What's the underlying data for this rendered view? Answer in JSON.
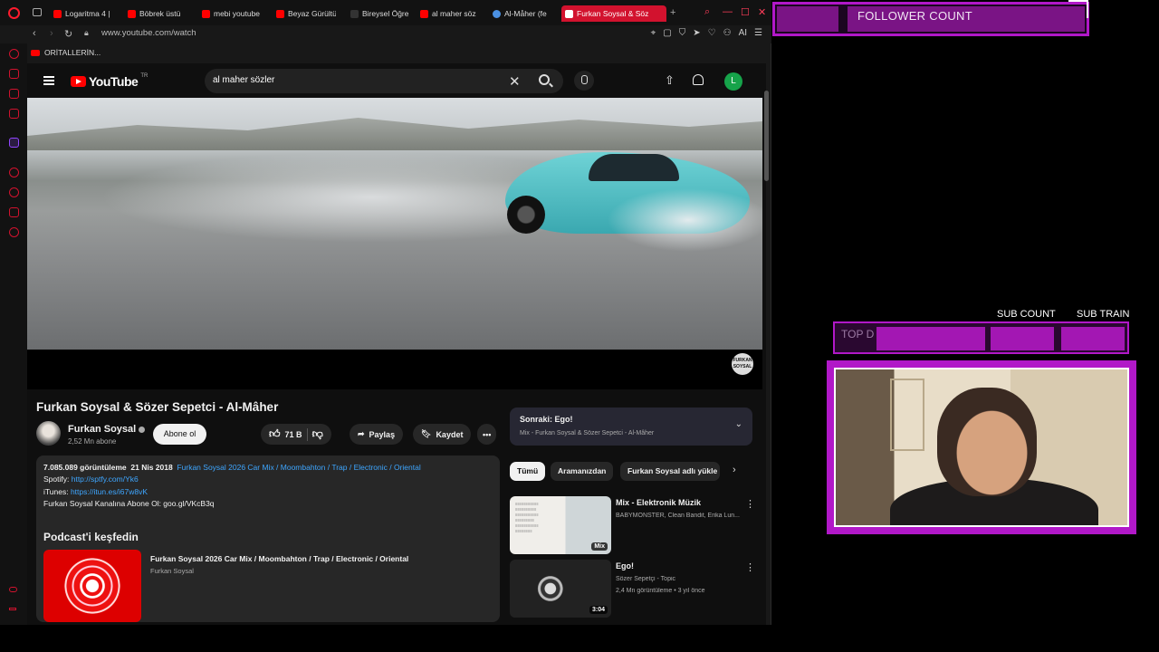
{
  "browser": {
    "tabs": [
      {
        "label": "Logaritma 4 |"
      },
      {
        "label": "Böbrek üstü"
      },
      {
        "label": "mebi youtube"
      },
      {
        "label": "Beyaz Gürültü"
      },
      {
        "label": "Bireysel Öğre"
      },
      {
        "label": "al maher söz"
      },
      {
        "label": "Al-Måher (fe"
      },
      {
        "label": "Furkan Soysal & Söz"
      }
    ],
    "url": "www.youtube.com/watch",
    "bookmark": "ORİTALLERİN...",
    "ai_label": "AI",
    "colors": {
      "accent": "#d2122e",
      "twitch": "#9146ff"
    }
  },
  "youtube": {
    "logo_text": "YouTube",
    "country": "TR",
    "search": {
      "value": "al maher  sözler"
    },
    "avatar_letter": "L",
    "watermark": "FURKAN SOYSAL",
    "video": {
      "title": "Furkan Soysal & Sözer Sepetci - Al-Mâher",
      "channel": "Furkan Soysal",
      "subs": "2,52 Mn abone",
      "subscribe": "Abone ol",
      "likes": "71 B",
      "share": "Paylaş",
      "save": "Kaydet",
      "more": "•••"
    },
    "description": {
      "views": "7.085.089 görüntüleme",
      "date": "21 Nis 2018",
      "tags": "Furkan Soysal 2026 Car Mix / Moombahton / Trap / Electronic / Oriental",
      "spotify_label": "Spotify:",
      "spotify_link": "http://sptfy.com/Yk6",
      "itunes_label": "iTunes:",
      "itunes_link": "https://itun.es/i67w8vK",
      "subscribe_line": "Furkan Soysal Kanalına Abone Ol: goo.gl/VKcB3q"
    },
    "podcast": {
      "heading": "Podcast'i keşfedin",
      "title": "Furkan Soysal 2026 Car Mix / Moombahton / Trap / Electronic / Oriental",
      "channel": "Furkan Soysal"
    },
    "up_next": {
      "title": "Sonraki: Ego!",
      "subtitle": "Mix - Furkan Soysal & Sözer Sepetci - Al-Mâher"
    },
    "chips": [
      "Tümü",
      "Aramanızdan",
      "Furkan Soysal adlı yükle"
    ],
    "recommendations": [
      {
        "title": "Mix - Elektronik Müzik",
        "meta1": "BABYMONSTER, Clean Bandit, Erika Lun...",
        "meta2": "",
        "badge": "Mix"
      },
      {
        "title": "Ego!",
        "meta1": "Sözer Sepetçi - Topic",
        "meta2": "2,4 Mn görüntüleme • 3 yıl önce",
        "badge": "3:04"
      }
    ]
  },
  "overlay": {
    "follower_count": "FOLLOWER COUNT",
    "sub_count": "SUB COUNT",
    "sub_train": "SUB TRAIN",
    "top_label": "TOP D"
  }
}
